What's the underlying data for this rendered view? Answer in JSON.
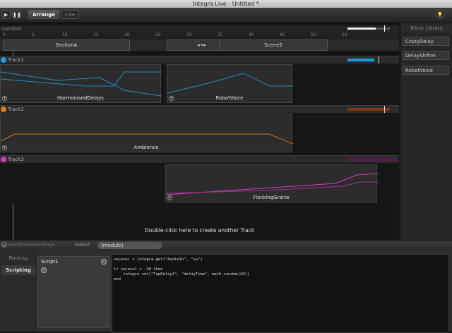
{
  "window": {
    "title": "Integra Live - Untitled *"
  },
  "toolbar": {
    "play_icon": "play-icon",
    "pause_icon": "pause-icon",
    "arrange_label": "Arrange",
    "live_label": "Live",
    "lightbulb_icon": "lightbulb-icon"
  },
  "project": {
    "title": "Untitled"
  },
  "ruler": {
    "ticks": [
      "0",
      "5",
      "10",
      "15",
      "20",
      "25",
      "30",
      "35",
      "40",
      "45",
      "50",
      "55"
    ]
  },
  "scenes": [
    {
      "label": "SectionA"
    },
    {
      "label": "Scene2"
    }
  ],
  "tracks": [
    {
      "name": "Track1",
      "color": "#1a9ee0",
      "blocks": [
        {
          "label": "HarmonisedDelays"
        },
        {
          "label": "RobotVoice"
        }
      ]
    },
    {
      "name": "Track2",
      "color": "#e07a1a",
      "blocks": [
        {
          "label": "Ambience"
        }
      ]
    },
    {
      "name": "Track3",
      "color": "#d33fc0",
      "blocks": [
        {
          "label": "FlockingGrains"
        }
      ]
    }
  ],
  "create_track_hint": "Double-click here to create another Track",
  "library": {
    "title": "Block Library",
    "items": [
      "CrazyDelay",
      "DelayShifter",
      "RobotVoice"
    ]
  },
  "bottom": {
    "selected_block": "HarmonisedDelays",
    "select_label": "Select",
    "select_value": "(module)",
    "tabs": [
      "Routing",
      "Scripting"
    ],
    "script_name": "Script1",
    "code": "vuLevel = integra.get(\"AudioIn\", \"vu\")\n\nif vuLevel > -30 then\n    integra.set(\"TapDelay1\", \"delayTime\", math.random(20))\nend"
  }
}
